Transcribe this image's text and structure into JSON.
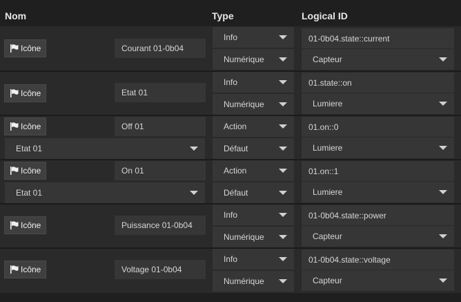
{
  "header": {
    "col_name": "Nom",
    "col_type": "Type",
    "col_logical": "Logical ID"
  },
  "icon_button_label": "Icône",
  "rows": [
    {
      "name": "Courant 01-0b04",
      "type": "Info",
      "subtype": "Numérique",
      "logical_id": "01-0b04.state::current",
      "generic": "Capteur"
    },
    {
      "name": "Etat 01",
      "type": "Info",
      "subtype": "Numérique",
      "logical_id": "01.state::on",
      "generic": "Lumiere"
    },
    {
      "name": "Off 01",
      "type": "Action",
      "subtype": "Défaut",
      "logical_id": "01.on::0",
      "generic": "Lumiere",
      "linked_info": "Etat 01"
    },
    {
      "name": "On 01",
      "type": "Action",
      "subtype": "Défaut",
      "logical_id": "01.on::1",
      "generic": "Lumiere",
      "linked_info": "Etat 01"
    },
    {
      "name": "Puissance 01-0b04",
      "type": "Info",
      "subtype": "Numérique",
      "logical_id": "01-0b04.state::power",
      "generic": "Capteur"
    },
    {
      "name": "Voltage 01-0b04",
      "type": "Info",
      "subtype": "Numérique",
      "logical_id": "01-0b04.state::voltage",
      "generic": "Capteur"
    }
  ]
}
